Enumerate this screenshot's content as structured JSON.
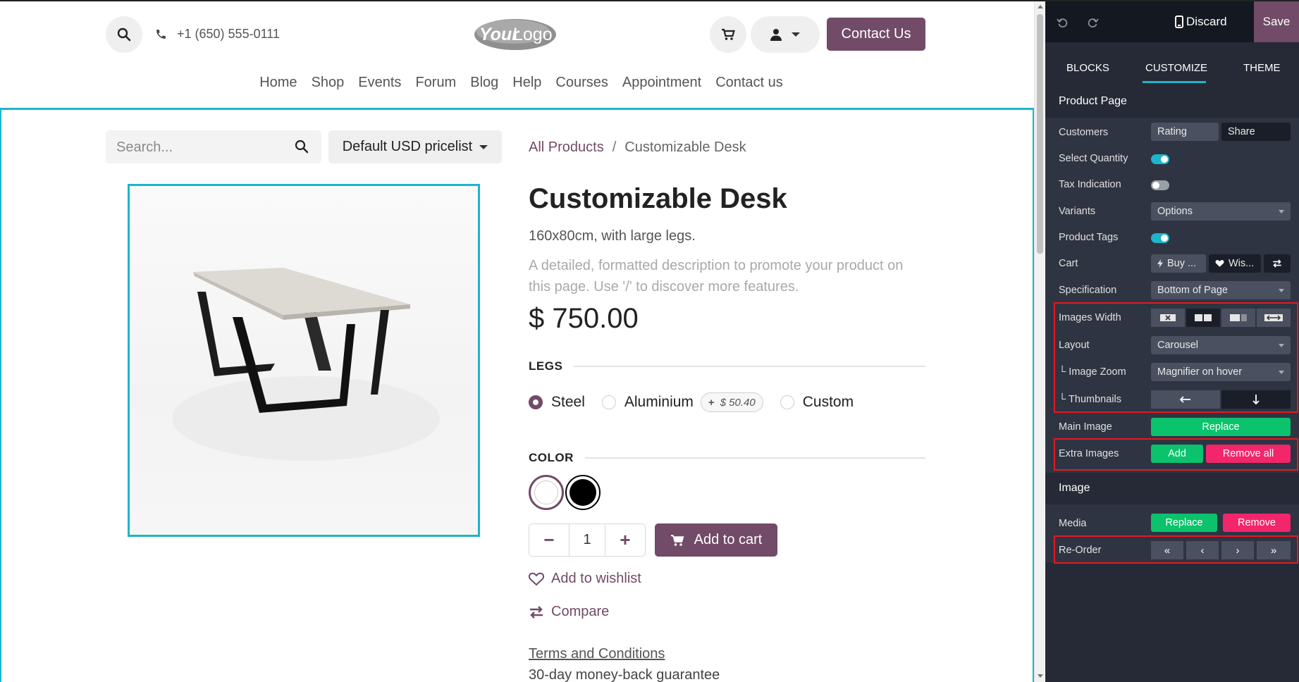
{
  "site": {
    "phone": "+1 (650) 555-0111",
    "logo_text_a": "Your",
    "logo_text_b": "Logo",
    "contact_button": "Contact Us",
    "menu": [
      "Home",
      "Shop",
      "Events",
      "Forum",
      "Blog",
      "Help",
      "Courses",
      "Appointment",
      "Contact us"
    ],
    "search_placeholder": "Search...",
    "pricelist": "Default USD pricelist",
    "breadcrumb": {
      "parent": "All Products",
      "separator": "/",
      "current": "Customizable Desk"
    },
    "product": {
      "name": "Customizable Desk",
      "subtitle": "160x80cm, with large legs.",
      "description": "A detailed, formatted description to promote your product on this page. Use '/' to discover more features.",
      "price": "$ 750.00"
    },
    "legs": {
      "heading": "LEGS",
      "options": [
        {
          "label": "Steel",
          "selected": true
        },
        {
          "label": "Aluminium",
          "extra": "$ 50.40",
          "extra_prefix": "+"
        },
        {
          "label": "Custom"
        }
      ]
    },
    "color": {
      "heading": "COLOR",
      "swatches": [
        {
          "name": "White",
          "hex": "#ffffff",
          "selected": true
        },
        {
          "name": "Black",
          "hex": "#000000"
        }
      ]
    },
    "quantity": "1",
    "add_to_cart": "Add to cart",
    "wishlist": "Add to wishlist",
    "compare": "Compare",
    "terms": "Terms and Conditions",
    "guarantee": "30-day money-back guarantee",
    "accent_color": "#714b67",
    "edit_highlight_color": "#1cb5cc"
  },
  "editor": {
    "discard": "Discard",
    "save": "Save",
    "tabs": [
      "BLOCKS",
      "CUSTOMIZE",
      "THEME"
    ],
    "active_tab": "CUSTOMIZE",
    "product_page": {
      "title": "Product Page",
      "customers": {
        "label": "Customers",
        "options": [
          "Rating",
          "Share"
        ]
      },
      "select_quantity": {
        "label": "Select Quantity",
        "on": true
      },
      "tax_indication": {
        "label": "Tax Indication",
        "on": false
      },
      "variants": {
        "label": "Variants",
        "value": "Options"
      },
      "product_tags": {
        "label": "Product Tags",
        "on": true
      },
      "cart": {
        "label": "Cart",
        "buy": "Buy ...",
        "wish": "Wis..."
      },
      "specification": {
        "label": "Specification",
        "value": "Bottom of Page"
      },
      "images_width": {
        "label": "Images Width"
      },
      "layout": {
        "label": "Layout",
        "value": "Carousel"
      },
      "image_zoom": {
        "label": "└ Image Zoom",
        "value": "Magnifier on hover"
      },
      "thumbnails": {
        "label": "└ Thumbnails",
        "left": "🠐",
        "bottom": "🠓"
      },
      "main_image": {
        "label": "Main Image",
        "button": "Replace"
      },
      "extra_images": {
        "label": "Extra Images",
        "add": "Add",
        "remove": "Remove all"
      }
    },
    "image": {
      "title": "Image",
      "media": {
        "label": "Media",
        "replace": "Replace",
        "remove": "Remove"
      },
      "reorder": {
        "label": "Re-Order",
        "buttons": [
          "«",
          "‹",
          "›",
          "»"
        ]
      }
    },
    "colors": {
      "green": "#0bc26d",
      "pink": "#f3266c",
      "toggle_on": "#1cb5cc",
      "highlight_box": "#e01b24"
    }
  }
}
